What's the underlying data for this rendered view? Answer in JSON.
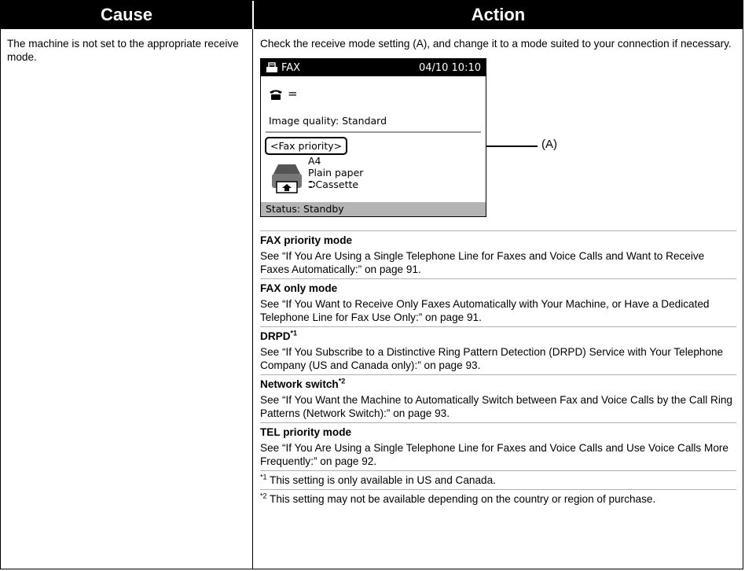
{
  "header": {
    "cause": "Cause",
    "action": "Action"
  },
  "cause_text": "The machine is not set to the appropriate receive mode.",
  "action_intro": "Check the receive mode setting (A), and change it to a mode suited to your connection if necessary.",
  "lcd": {
    "title": "FAX",
    "datetime": "04/10 10:10",
    "phone_value": "=",
    "image_quality": "Image quality: Standard",
    "mode": "<Fax priority>",
    "paper_size": "A4",
    "paper_type": "Plain paper",
    "paper_source": "Cassette",
    "status": "Status: Standby",
    "callout": "(A)"
  },
  "modes": [
    {
      "title": "FAX priority mode",
      "sup": "",
      "desc": "See “If You Are Using a Single Telephone Line for Faxes and Voice Calls and Want to Receive Faxes Automatically:” on page 91."
    },
    {
      "title": "FAX only mode",
      "sup": "",
      "desc": "See “If You Want to Receive Only Faxes Automatically with Your Machine, or Have a Dedicated Telephone Line for Fax Use Only:” on page 91."
    },
    {
      "title": "DRPD",
      "sup": "*1",
      "desc": "See “If You Subscribe to a Distinctive Ring Pattern Detection (DRPD) Service with Your Telephone Company (US and Canada only):” on page 93."
    },
    {
      "title": "Network switch",
      "sup": "*2",
      "desc": "See “If You Want the Machine to Automatically Switch between Fax and Voice Calls by the Call Ring Patterns (Network Switch):” on page 93."
    },
    {
      "title": "TEL priority mode",
      "sup": "",
      "desc": "See “If You Are Using a Single Telephone Line for Faxes and Voice Calls and Use Voice Calls More Frequently:” on page 92."
    }
  ],
  "notes": [
    {
      "mark": "*1",
      "text": " This setting is only available in US and Canada."
    },
    {
      "mark": "*2",
      "text": " This setting may not be available depending on the country or region of purchase."
    }
  ]
}
